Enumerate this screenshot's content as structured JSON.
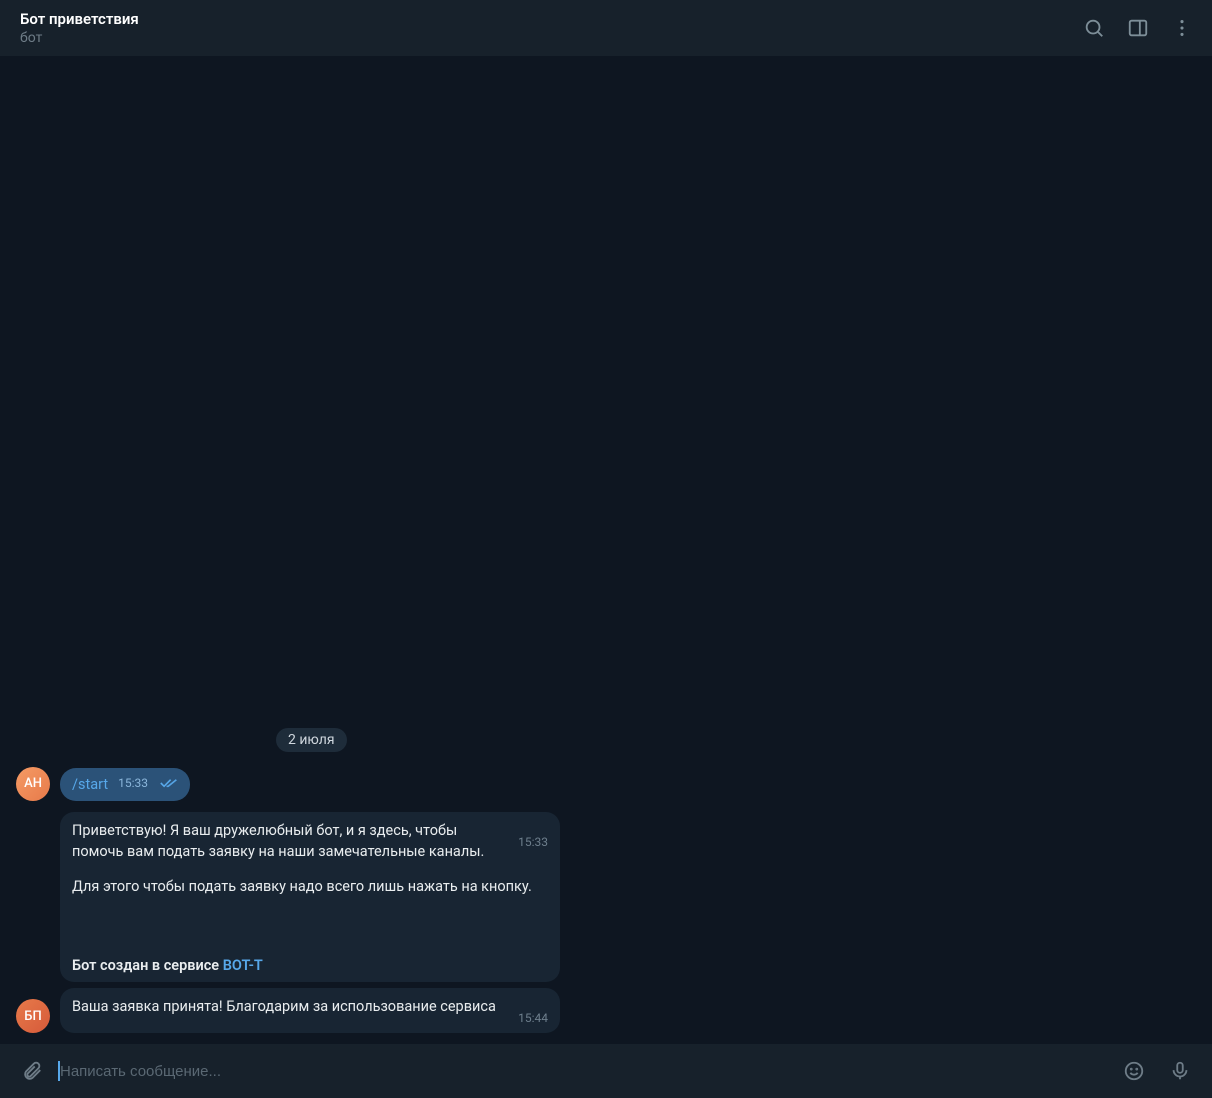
{
  "header": {
    "title": "Бот приветствия",
    "subtitle": "бот"
  },
  "date_label": "2 июля",
  "avatars": {
    "user": "АН",
    "bot": "БП"
  },
  "messages": {
    "m1": {
      "text": "/start",
      "time": "15:33"
    },
    "m2": {
      "para1": "Приветствую! Я ваш дружелюбный бот, и я здесь, чтобы помочь вам подать заявку на наши замечательные каналы.",
      "para2": "Для этого чтобы подать заявку надо всего лишь нажать на кнопку.",
      "credit_prefix": "Бот создан в сервисе ",
      "credit_link": "BOT-T",
      "time": "15:33"
    },
    "m3": {
      "text": "Ваша заявка принята! Благодарим за использование сервиса",
      "time": "15:44"
    }
  },
  "composer": {
    "placeholder": "Написать сообщение..."
  }
}
